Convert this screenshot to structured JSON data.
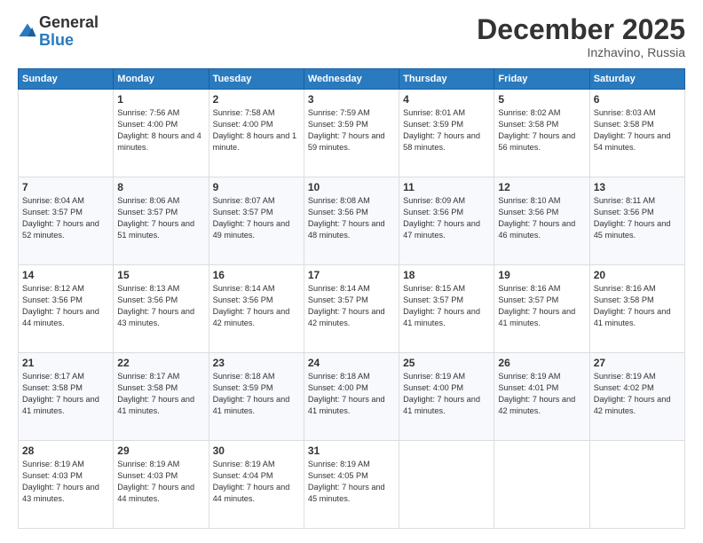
{
  "header": {
    "logo_line1": "General",
    "logo_line2": "Blue",
    "month": "December 2025",
    "location": "Inzhavino, Russia"
  },
  "weekdays": [
    "Sunday",
    "Monday",
    "Tuesday",
    "Wednesday",
    "Thursday",
    "Friday",
    "Saturday"
  ],
  "weeks": [
    [
      {
        "day": "",
        "sunrise": "",
        "sunset": "",
        "daylight": ""
      },
      {
        "day": "1",
        "sunrise": "7:56 AM",
        "sunset": "4:00 PM",
        "daylight": "8 hours and 4 minutes."
      },
      {
        "day": "2",
        "sunrise": "7:58 AM",
        "sunset": "4:00 PM",
        "daylight": "8 hours and 1 minute."
      },
      {
        "day": "3",
        "sunrise": "7:59 AM",
        "sunset": "3:59 PM",
        "daylight": "7 hours and 59 minutes."
      },
      {
        "day": "4",
        "sunrise": "8:01 AM",
        "sunset": "3:59 PM",
        "daylight": "7 hours and 58 minutes."
      },
      {
        "day": "5",
        "sunrise": "8:02 AM",
        "sunset": "3:58 PM",
        "daylight": "7 hours and 56 minutes."
      },
      {
        "day": "6",
        "sunrise": "8:03 AM",
        "sunset": "3:58 PM",
        "daylight": "7 hours and 54 minutes."
      }
    ],
    [
      {
        "day": "7",
        "sunrise": "8:04 AM",
        "sunset": "3:57 PM",
        "daylight": "7 hours and 52 minutes."
      },
      {
        "day": "8",
        "sunrise": "8:06 AM",
        "sunset": "3:57 PM",
        "daylight": "7 hours and 51 minutes."
      },
      {
        "day": "9",
        "sunrise": "8:07 AM",
        "sunset": "3:57 PM",
        "daylight": "7 hours and 49 minutes."
      },
      {
        "day": "10",
        "sunrise": "8:08 AM",
        "sunset": "3:56 PM",
        "daylight": "7 hours and 48 minutes."
      },
      {
        "day": "11",
        "sunrise": "8:09 AM",
        "sunset": "3:56 PM",
        "daylight": "7 hours and 47 minutes."
      },
      {
        "day": "12",
        "sunrise": "8:10 AM",
        "sunset": "3:56 PM",
        "daylight": "7 hours and 46 minutes."
      },
      {
        "day": "13",
        "sunrise": "8:11 AM",
        "sunset": "3:56 PM",
        "daylight": "7 hours and 45 minutes."
      }
    ],
    [
      {
        "day": "14",
        "sunrise": "8:12 AM",
        "sunset": "3:56 PM",
        "daylight": "7 hours and 44 minutes."
      },
      {
        "day": "15",
        "sunrise": "8:13 AM",
        "sunset": "3:56 PM",
        "daylight": "7 hours and 43 minutes."
      },
      {
        "day": "16",
        "sunrise": "8:14 AM",
        "sunset": "3:56 PM",
        "daylight": "7 hours and 42 minutes."
      },
      {
        "day": "17",
        "sunrise": "8:14 AM",
        "sunset": "3:57 PM",
        "daylight": "7 hours and 42 minutes."
      },
      {
        "day": "18",
        "sunrise": "8:15 AM",
        "sunset": "3:57 PM",
        "daylight": "7 hours and 41 minutes."
      },
      {
        "day": "19",
        "sunrise": "8:16 AM",
        "sunset": "3:57 PM",
        "daylight": "7 hours and 41 minutes."
      },
      {
        "day": "20",
        "sunrise": "8:16 AM",
        "sunset": "3:58 PM",
        "daylight": "7 hours and 41 minutes."
      }
    ],
    [
      {
        "day": "21",
        "sunrise": "8:17 AM",
        "sunset": "3:58 PM",
        "daylight": "7 hours and 41 minutes."
      },
      {
        "day": "22",
        "sunrise": "8:17 AM",
        "sunset": "3:58 PM",
        "daylight": "7 hours and 41 minutes."
      },
      {
        "day": "23",
        "sunrise": "8:18 AM",
        "sunset": "3:59 PM",
        "daylight": "7 hours and 41 minutes."
      },
      {
        "day": "24",
        "sunrise": "8:18 AM",
        "sunset": "4:00 PM",
        "daylight": "7 hours and 41 minutes."
      },
      {
        "day": "25",
        "sunrise": "8:19 AM",
        "sunset": "4:00 PM",
        "daylight": "7 hours and 41 minutes."
      },
      {
        "day": "26",
        "sunrise": "8:19 AM",
        "sunset": "4:01 PM",
        "daylight": "7 hours and 42 minutes."
      },
      {
        "day": "27",
        "sunrise": "8:19 AM",
        "sunset": "4:02 PM",
        "daylight": "7 hours and 42 minutes."
      }
    ],
    [
      {
        "day": "28",
        "sunrise": "8:19 AM",
        "sunset": "4:03 PM",
        "daylight": "7 hours and 43 minutes."
      },
      {
        "day": "29",
        "sunrise": "8:19 AM",
        "sunset": "4:03 PM",
        "daylight": "7 hours and 44 minutes."
      },
      {
        "day": "30",
        "sunrise": "8:19 AM",
        "sunset": "4:04 PM",
        "daylight": "7 hours and 44 minutes."
      },
      {
        "day": "31",
        "sunrise": "8:19 AM",
        "sunset": "4:05 PM",
        "daylight": "7 hours and 45 minutes."
      },
      {
        "day": "",
        "sunrise": "",
        "sunset": "",
        "daylight": ""
      },
      {
        "day": "",
        "sunrise": "",
        "sunset": "",
        "daylight": ""
      },
      {
        "day": "",
        "sunrise": "",
        "sunset": "",
        "daylight": ""
      }
    ]
  ]
}
